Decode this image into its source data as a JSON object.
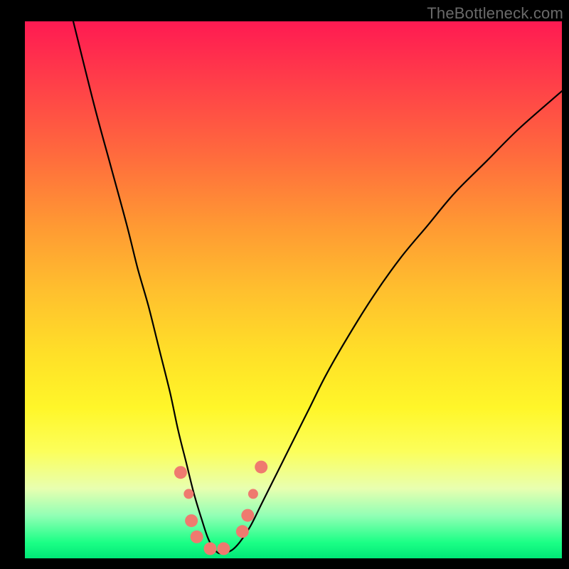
{
  "watermark": "TheBottleneck.com",
  "chart_data": {
    "type": "line",
    "title": "",
    "xlabel": "",
    "ylabel": "",
    "xlim": [
      0,
      100
    ],
    "ylim": [
      0,
      100
    ],
    "series": [
      {
        "name": "curve",
        "x": [
          9,
          13,
          16,
          19,
          21,
          23,
          25,
          27,
          28.5,
          30,
          31.5,
          33,
          34,
          35,
          36,
          37,
          38.5,
          40,
          42,
          44,
          46,
          48,
          50,
          53,
          56,
          60,
          65,
          70,
          75,
          80,
          86,
          92,
          100
        ],
        "y": [
          100,
          84,
          73,
          62,
          54,
          47,
          39,
          31,
          24,
          18,
          12,
          7,
          4,
          2,
          1,
          1,
          1.5,
          3,
          6,
          10,
          14,
          18,
          22,
          28,
          34,
          41,
          49,
          56,
          62,
          68,
          74,
          80,
          87
        ]
      }
    ],
    "markers": [
      {
        "x": 29,
        "y": 16,
        "r": 9
      },
      {
        "x": 30.5,
        "y": 12,
        "r": 7
      },
      {
        "x": 31,
        "y": 7,
        "r": 9
      },
      {
        "x": 32,
        "y": 4,
        "r": 9
      },
      {
        "x": 34.5,
        "y": 1.8,
        "r": 9
      },
      {
        "x": 37,
        "y": 1.8,
        "r": 9
      },
      {
        "x": 40.5,
        "y": 5,
        "r": 9
      },
      {
        "x": 41.5,
        "y": 8,
        "r": 9
      },
      {
        "x": 42.5,
        "y": 12,
        "r": 7
      },
      {
        "x": 44,
        "y": 17,
        "r": 9
      }
    ],
    "gradient_stops": [
      {
        "pos": 0,
        "color": "#ff1a52"
      },
      {
        "pos": 25,
        "color": "#ff6b3d"
      },
      {
        "pos": 50,
        "color": "#ffbf2e"
      },
      {
        "pos": 75,
        "color": "#fff629"
      },
      {
        "pos": 92,
        "color": "#92ffb5"
      },
      {
        "pos": 100,
        "color": "#00e877"
      }
    ]
  }
}
